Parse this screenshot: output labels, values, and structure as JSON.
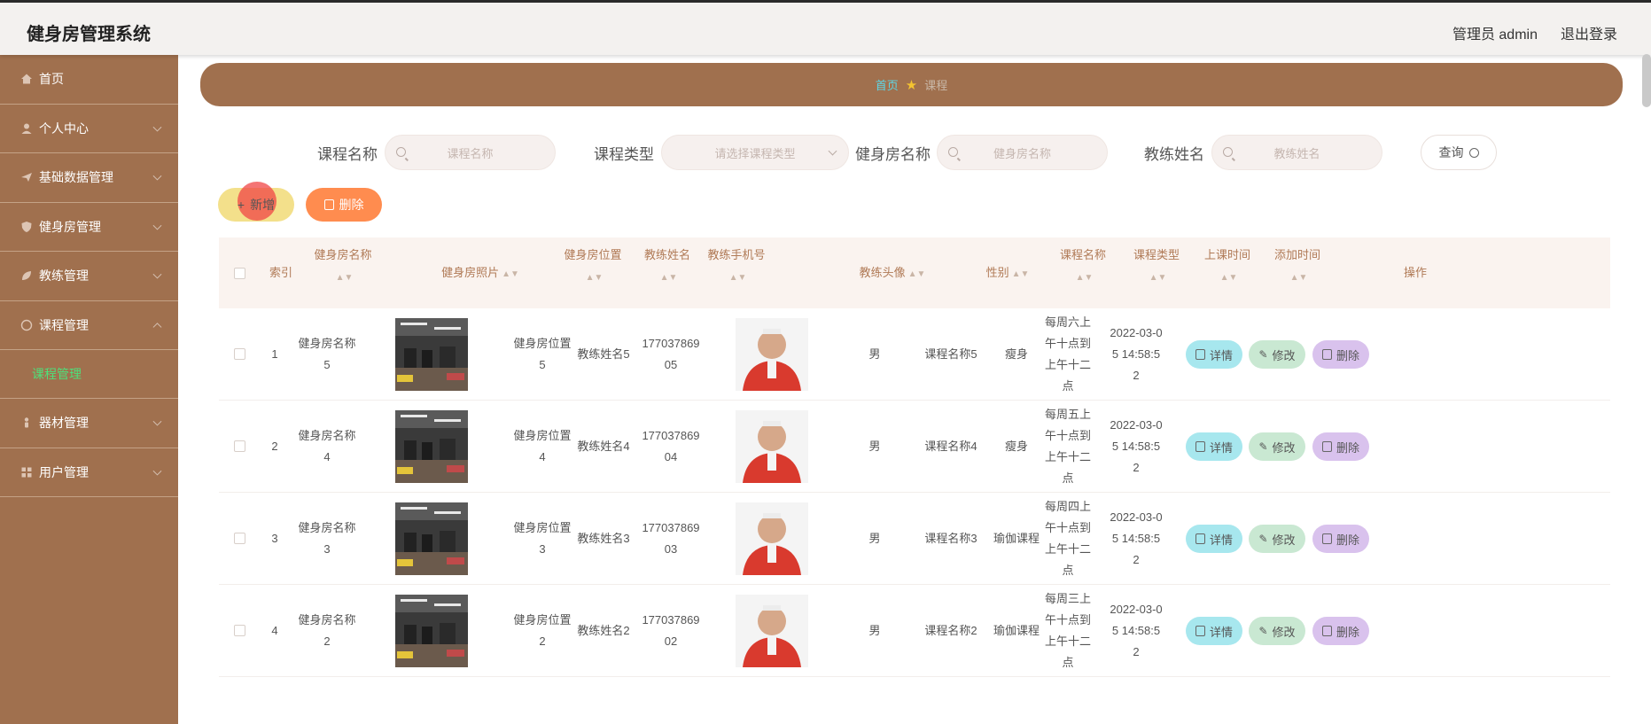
{
  "header": {
    "app_title": "健身房管理系统",
    "user": "管理员 admin",
    "logout": "退出登录"
  },
  "sidebar": {
    "items": [
      {
        "label": "首页",
        "icon": "home-icon"
      },
      {
        "label": "个人中心",
        "icon": "user-icon"
      },
      {
        "label": "基础数据管理",
        "icon": "send-icon"
      },
      {
        "label": "健身房管理",
        "icon": "shield-icon"
      },
      {
        "label": "教练管理",
        "icon": "leaf-icon"
      },
      {
        "label": "课程管理",
        "icon": "circle-icon"
      },
      {
        "label": "器材管理",
        "icon": "person-icon"
      },
      {
        "label": "用户管理",
        "icon": "grid-icon"
      }
    ],
    "active_sub": "课程管理"
  },
  "breadcrumb": {
    "home": "首页",
    "current": "课程"
  },
  "search": {
    "course_name_label": "课程名称",
    "course_name_placeholder": "课程名称",
    "course_type_label": "课程类型",
    "course_type_placeholder": "请选择课程类型",
    "gym_name_label": "健身房名称",
    "gym_name_placeholder": "健身房名称",
    "coach_name_label": "教练姓名",
    "coach_name_placeholder": "教练姓名",
    "query_label": "查询"
  },
  "actions": {
    "add_label": "新增",
    "delete_label": "删除"
  },
  "table": {
    "headers": {
      "index": "索引",
      "gym_name": "健身房名称",
      "gym_photo": "健身房照片",
      "gym_location": "健身房位置",
      "coach_name": "教练姓名",
      "coach_phone": "教练手机号",
      "coach_avatar": "教练头像",
      "gender": "性别",
      "course_name": "课程名称",
      "course_type": "课程类型",
      "class_time": "上课时间",
      "added_time": "添加时间",
      "operation": "操作"
    },
    "op_labels": {
      "detail": "详情",
      "edit": "修改",
      "delete": "删除"
    },
    "rows": [
      {
        "index": "1",
        "gym_name": "健身房名称5",
        "gym_location": "健身房位置5",
        "coach_name": "教练姓名5",
        "coach_phone": "17703786905",
        "gender": "男",
        "course_name": "课程名称5",
        "course_type": "瘦身",
        "class_time": "每周六上午十点到上午十二点",
        "added_time": "2022-03-05 14:58:52"
      },
      {
        "index": "2",
        "gym_name": "健身房名称4",
        "gym_location": "健身房位置4",
        "coach_name": "教练姓名4",
        "coach_phone": "17703786904",
        "gender": "男",
        "course_name": "课程名称4",
        "course_type": "瘦身",
        "class_time": "每周五上午十点到上午十二点",
        "added_time": "2022-03-05 14:58:52"
      },
      {
        "index": "3",
        "gym_name": "健身房名称3",
        "gym_location": "健身房位置3",
        "coach_name": "教练姓名3",
        "coach_phone": "17703786903",
        "gender": "男",
        "course_name": "课程名称3",
        "course_type": "瑜伽课程",
        "class_time": "每周四上午十点到上午十二点",
        "added_time": "2022-03-05 14:58:52"
      },
      {
        "index": "4",
        "gym_name": "健身房名称2",
        "gym_location": "健身房位置2",
        "coach_name": "教练姓名2",
        "coach_phone": "17703786902",
        "gender": "男",
        "course_name": "课程名称2",
        "course_type": "瑜伽课程",
        "class_time": "每周三上午十点到上午十二点",
        "added_time": "2022-03-05 14:58:52"
      }
    ]
  },
  "colors": {
    "sidebar_bg": "#a0704e",
    "active_sub": "#4ee07a",
    "add_btn": "#f3e08b",
    "delete_btn": "#ff8c4f",
    "detail_btn": "#a7e7ee",
    "edit_btn": "#c9e8d2",
    "row_delete_btn": "#d9c2ed"
  }
}
